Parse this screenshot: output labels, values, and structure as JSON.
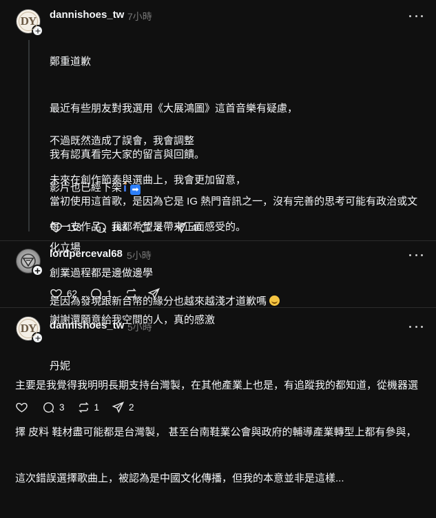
{
  "posts": [
    {
      "username": "dannishoes_tw",
      "time": "7小時",
      "avatar_text": "DY",
      "lines": [
        "鄭重道歉",
        "最近有些朋友對我選用《大展鴻圖》這首音樂有疑慮，",
        "我有認真看完大家的留言與回饋。",
        "當初使用這首歌，是因為它是 IG 熱門音訊之一，沒有完善的思考可能有政治或文",
        "化立場"
      ],
      "lines2": [
        "不過既然造成了誤會，我會調整",
        "影片也已經下架"
      ],
      "lines3": [
        "未來在創作節奏與選曲上，我會更加留意，",
        "每一支作品，我都希望是帶來正面感受的。",
        "創業過程都是邊做邊學",
        "謝謝還願意給我空間的人，真的感激",
        "丹妮"
      ],
      "likes": "113",
      "comments": "163",
      "reposts": "8",
      "shares": "40"
    },
    {
      "username": "lordperceval68",
      "time": "5小時",
      "text": "是因為發現跟新台幣的緣分也越來越淺才道歉嗎",
      "likes": "62",
      "comments": "1",
      "reposts": "",
      "shares": ""
    },
    {
      "username": "dannishoes_tw",
      "time": "5小時",
      "avatar_text": "DY",
      "lines": [
        "主要是我覺得我明明長期支持台灣製，在其他產業上也是，有追蹤我的都知道，從機器選",
        "擇 皮料 鞋材盡可能都是台灣製， 甚至台南鞋業公會與政府的輔導產業轉型上都有參與，",
        "這次錯誤選擇歌曲上，被認為是中國文化傳播，但我的本意並非是這樣..."
      ],
      "likes": "",
      "comments": "3",
      "reposts": "1",
      "shares": "2"
    }
  ],
  "colors": {
    "background": "#101010",
    "text": "#f3f5f7",
    "muted": "#777777"
  }
}
